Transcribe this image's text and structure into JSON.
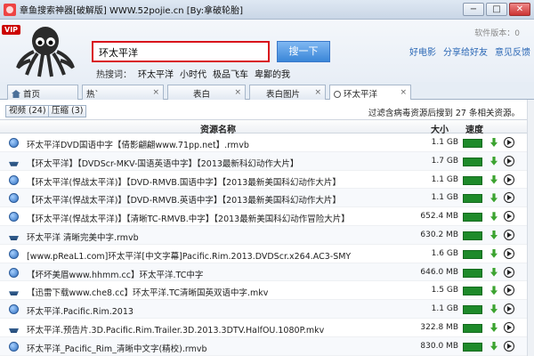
{
  "window": {
    "title": "章鱼搜索神器[破解版] WWW.52pojie.cn [By:拿破轮胎]",
    "min": "−",
    "max": "□",
    "close": "✕"
  },
  "header": {
    "vip": "VIP",
    "search_value": "环太平洋",
    "search_button": "搜一下",
    "version": "软件版本：0",
    "links": [
      "好电影",
      "分享给好友",
      "意见反馈"
    ],
    "hot_label": "热搜词：",
    "hot_keywords": [
      "环太平洋",
      "小时代",
      "极品飞车",
      "卑鄙的我"
    ]
  },
  "tabs": [
    {
      "label": "首页",
      "icon": "home-icon"
    },
    {
      "label": "热`",
      "close": "×"
    },
    {
      "label": "表白",
      "close": "×"
    },
    {
      "label": "表白图片",
      "close": "×"
    },
    {
      "label": "环太平洋",
      "icon": "search-icon",
      "close": "×"
    }
  ],
  "filters": {
    "chips": [
      "视频 (24)",
      "压缩 (3)"
    ],
    "note": "过滤含病毒资源后搜到 27 条相关资源。"
  },
  "table": {
    "headers": {
      "name": "资源名称",
      "size": "大小",
      "speed": "速度"
    },
    "rows": [
      {
        "icon": "globe",
        "name": "环太平洋DVD国语中字【倩影翩翩www.71pp.net】.rmvb",
        "size": "1.1 GB"
      },
      {
        "icon": "boat",
        "name": "【环太平洋】【DVDScr-MKV-国语英语中字】【2013最新科幻动作大片】",
        "size": "1.7 GB"
      },
      {
        "icon": "globe",
        "name": "【环太平洋(悍战太平洋)】【DVD-RMVB.国语中字】【2013最新美国科幻动作大片】",
        "size": "1.1 GB"
      },
      {
        "icon": "globe",
        "name": "【环太平洋(悍战太平洋)】【DVD-RMVB.英语中字】【2013最新美国科幻动作大片】",
        "size": "1.1 GB"
      },
      {
        "icon": "globe",
        "name": "【环太平洋(悍战太平洋)】【清晰TC-RMVB.中字】【2013最新美国科幻动作冒险大片】",
        "size": "652.4 MB"
      },
      {
        "icon": "boat",
        "name": "环太平洋 清晰完美中字.rmvb",
        "size": "630.2 MB"
      },
      {
        "icon": "globe",
        "name": "[www.pReaL1.com]环太平洋[中文字幕]Pacific.Rim.2013.DVDScr.x264.AC3-SMY",
        "size": "1.6 GB"
      },
      {
        "icon": "globe",
        "name": "【坏坏美眉www.hhmm.cc】环太平洋.TC中字",
        "size": "646.0 MB"
      },
      {
        "icon": "boat",
        "name": "【迅雷下载www.che8.cc】环太平洋.TC清晰国英双语中字.mkv",
        "size": "1.5 GB"
      },
      {
        "icon": "globe",
        "name": "环太平洋.Pacific.Rim.2013",
        "size": "1.1 GB"
      },
      {
        "icon": "boat",
        "name": "环太平洋.预告片.3D.Pacific.Rim.Trailer.3D.2013.3DTV.HalfOU.1080P.mkv",
        "size": "322.8 MB"
      },
      {
        "icon": "globe",
        "name": "环太平洋_Pacific_Rim_清晰中文字(精校).rmvb",
        "size": "830.0 MB"
      }
    ]
  }
}
